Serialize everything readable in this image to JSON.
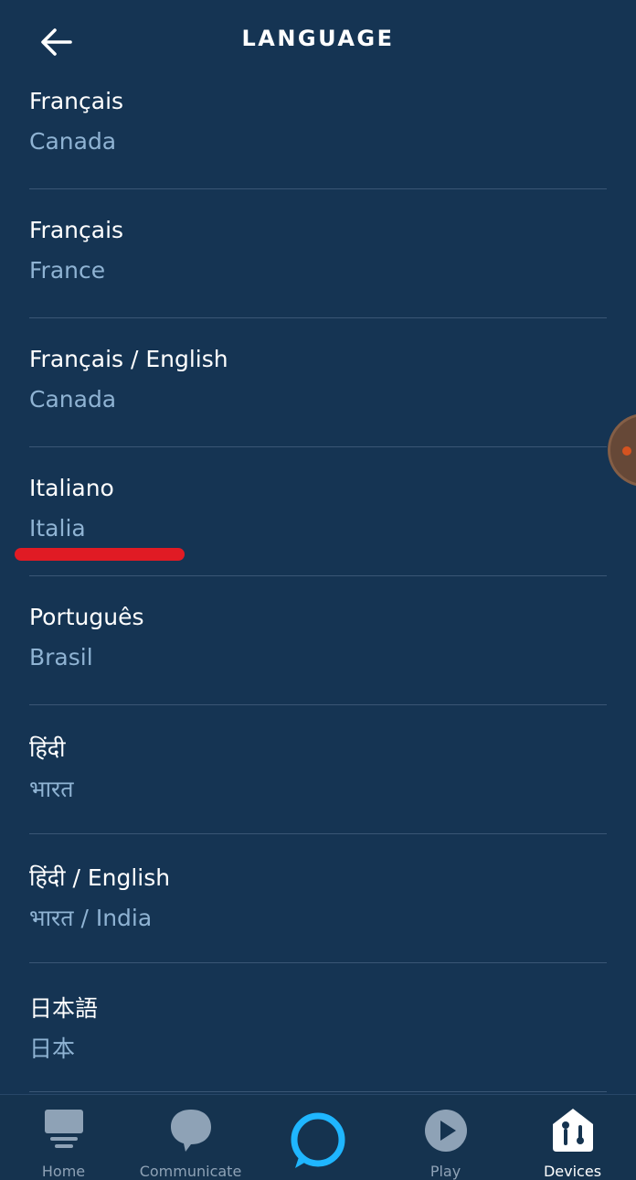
{
  "header": {
    "title": "LANGUAGE",
    "back_icon": "arrow-left-icon"
  },
  "languages": [
    {
      "name": "Français",
      "region": "Canada"
    },
    {
      "name": "Français",
      "region": "France"
    },
    {
      "name": "Français / English",
      "region": "Canada"
    },
    {
      "name": "Italiano",
      "region": "Italia"
    },
    {
      "name": "Português",
      "region": "Brasil"
    },
    {
      "name": "हिंदी",
      "region": "भारत"
    },
    {
      "name": "हिंदी / English",
      "region": "भारत / India"
    },
    {
      "name": "日本語",
      "region": "日本"
    }
  ],
  "bottom_nav": {
    "items": [
      {
        "label": "Home",
        "icon": "home-icon"
      },
      {
        "label": "Communicate",
        "icon": "chat-bubble-icon"
      },
      {
        "label": "",
        "icon": "alexa-ring-icon"
      },
      {
        "label": "Play",
        "icon": "play-icon"
      },
      {
        "label": "Devices",
        "icon": "devices-icon",
        "active": true
      }
    ]
  },
  "colors": {
    "background": "#153453",
    "primary_text": "#ffffff",
    "secondary_text": "#8fb3d3",
    "divider": "#3a5675",
    "alexa_accent": "#1fb6ff",
    "highlight_underline": "#e01b24",
    "nav_inactive": "#8ea2b6"
  }
}
